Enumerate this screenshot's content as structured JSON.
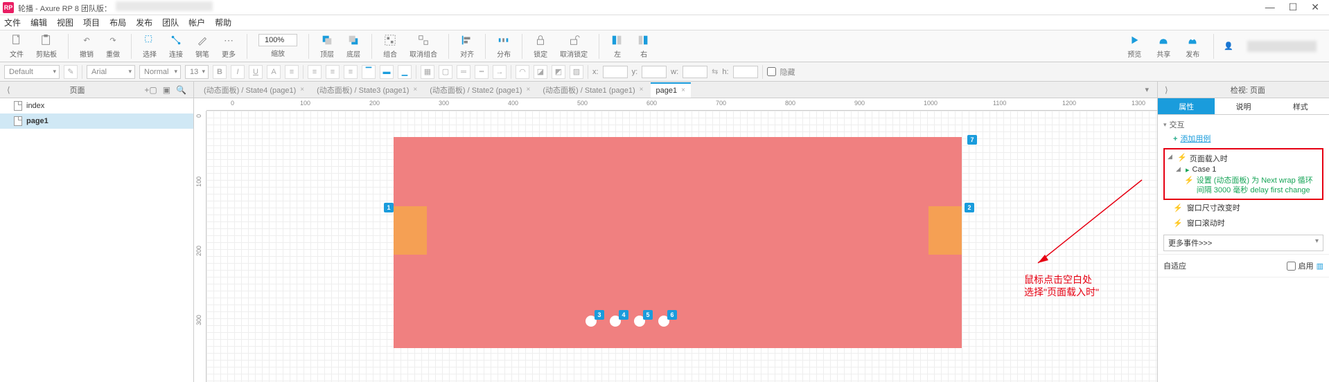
{
  "app": {
    "logo": "RP",
    "title": "轮播 - Axure RP 8 团队版："
  },
  "menubar": [
    "文件",
    "编辑",
    "视图",
    "项目",
    "布局",
    "发布",
    "团队",
    "帐户",
    "帮助"
  ],
  "toolbar": {
    "file": "文件",
    "clipboard": "剪贴板",
    "undo": "撤销",
    "redo": "重做",
    "select": "选择",
    "connect": "连接",
    "pen": "钢笔",
    "more": "更多",
    "zoom": "100%",
    "zoom_lbl": "缩放",
    "top": "顶层",
    "bottom": "底层",
    "group": "组合",
    "ungroup": "取消组合",
    "align": "对齐",
    "distribute": "分布",
    "lock": "锁定",
    "unlock": "取消锁定",
    "left": "左",
    "right": "右",
    "preview": "预览",
    "share": "共享",
    "publish": "发布"
  },
  "formatbar": {
    "style": "Default",
    "font": "Arial",
    "weight": "Normal",
    "size": "13",
    "x": "x:",
    "y": "y:",
    "w": "w:",
    "h": "h:",
    "hidden": "隐藏"
  },
  "left": {
    "panel_title": "页面",
    "items": [
      {
        "label": "index",
        "active": false
      },
      {
        "label": "page1",
        "active": true
      }
    ]
  },
  "tabs": [
    {
      "label": "(动态面板) / State4 (page1)",
      "active": false
    },
    {
      "label": "(动态面板) / State3 (page1)",
      "active": false
    },
    {
      "label": "(动态面板) / State2 (page1)",
      "active": false
    },
    {
      "label": "(动态面板) / State1 (page1)",
      "active": false
    },
    {
      "label": "page1",
      "active": true
    }
  ],
  "ruler_h": [
    "0",
    "100",
    "200",
    "300",
    "400",
    "500",
    "600",
    "700",
    "800",
    "900",
    "1000",
    "1100",
    "1200",
    "1300"
  ],
  "ruler_v": [
    "0",
    "100",
    "200",
    "300"
  ],
  "markers": {
    "m1": "1",
    "m2": "2",
    "m3": "3",
    "m4": "4",
    "m5": "5",
    "m6": "6",
    "m7": "7"
  },
  "annotation": {
    "line1": "鼠标点击空白处",
    "line2": "选择\"页面载入时\""
  },
  "right": {
    "header_title": "检视: 页面",
    "tabs": [
      "属性",
      "说明",
      "样式"
    ],
    "section_interaction": "交互",
    "add_case": "添加用例",
    "event_page_load": "页面载入时",
    "case1": "Case 1",
    "action": "设置 (动态面板) 为 Next wrap 循环间隔 3000 毫秒 delay first change",
    "event_resize": "窗口尺寸改变时",
    "event_scroll": "窗口滚动时",
    "more_events": "更多事件>>>",
    "adaptive": "自适应",
    "enable": "启用"
  }
}
